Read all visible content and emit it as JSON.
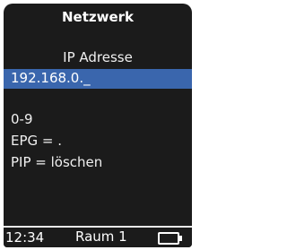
{
  "header": {
    "title": "Netzwerk"
  },
  "main": {
    "field_label": "IP Adresse",
    "ip_value": "192.168.0._",
    "hints": [
      "0-9",
      "EPG = .",
      "PIP = löschen"
    ]
  },
  "statusbar": {
    "time": "12:34",
    "room": "Raum 1",
    "battery_icon": "battery-icon"
  },
  "colors": {
    "screen_bg": "#1b1b1b",
    "highlight": "#3a66ad",
    "text": "#ffffff"
  }
}
